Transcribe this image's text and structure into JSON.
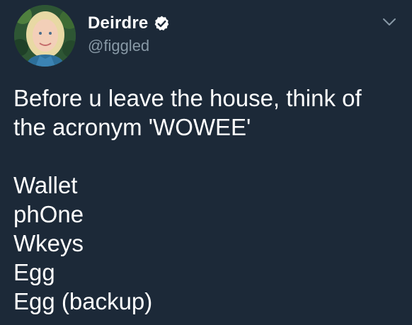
{
  "user": {
    "display_name": "Deirdre",
    "handle": "@figgled",
    "verified": true
  },
  "icons": {
    "verified": "verified-badge-icon",
    "caret": "chevron-down-icon"
  },
  "tweet": {
    "intro_line_1": "Before u leave the house, think of",
    "intro_line_2": "the acronym 'WOWEE'",
    "list": [
      "Wallet",
      "phOne",
      "Wkeys",
      "Egg",
      "Egg (backup)"
    ]
  },
  "colors": {
    "background": "#1c2938",
    "text": "#ffffff",
    "secondary_text": "#8899a6"
  }
}
